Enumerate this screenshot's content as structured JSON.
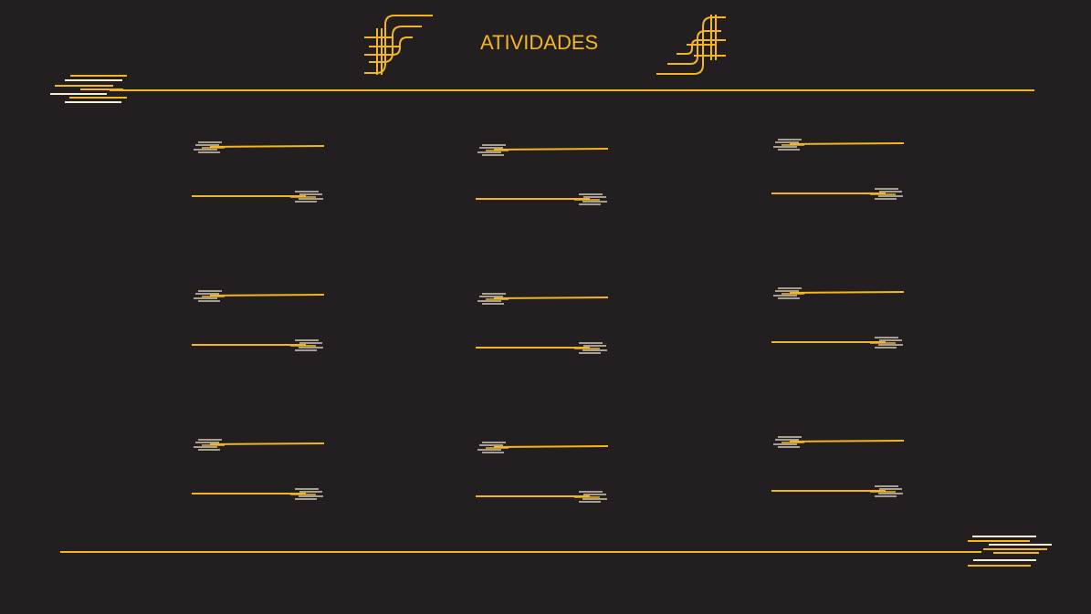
{
  "page": {
    "title": "ATIVIDADES"
  },
  "colors": {
    "background": "#231f20",
    "accent": "#f3b623",
    "light_stroke": "#f5ecd4"
  },
  "slots": {
    "columns": 3,
    "rows": 3
  }
}
